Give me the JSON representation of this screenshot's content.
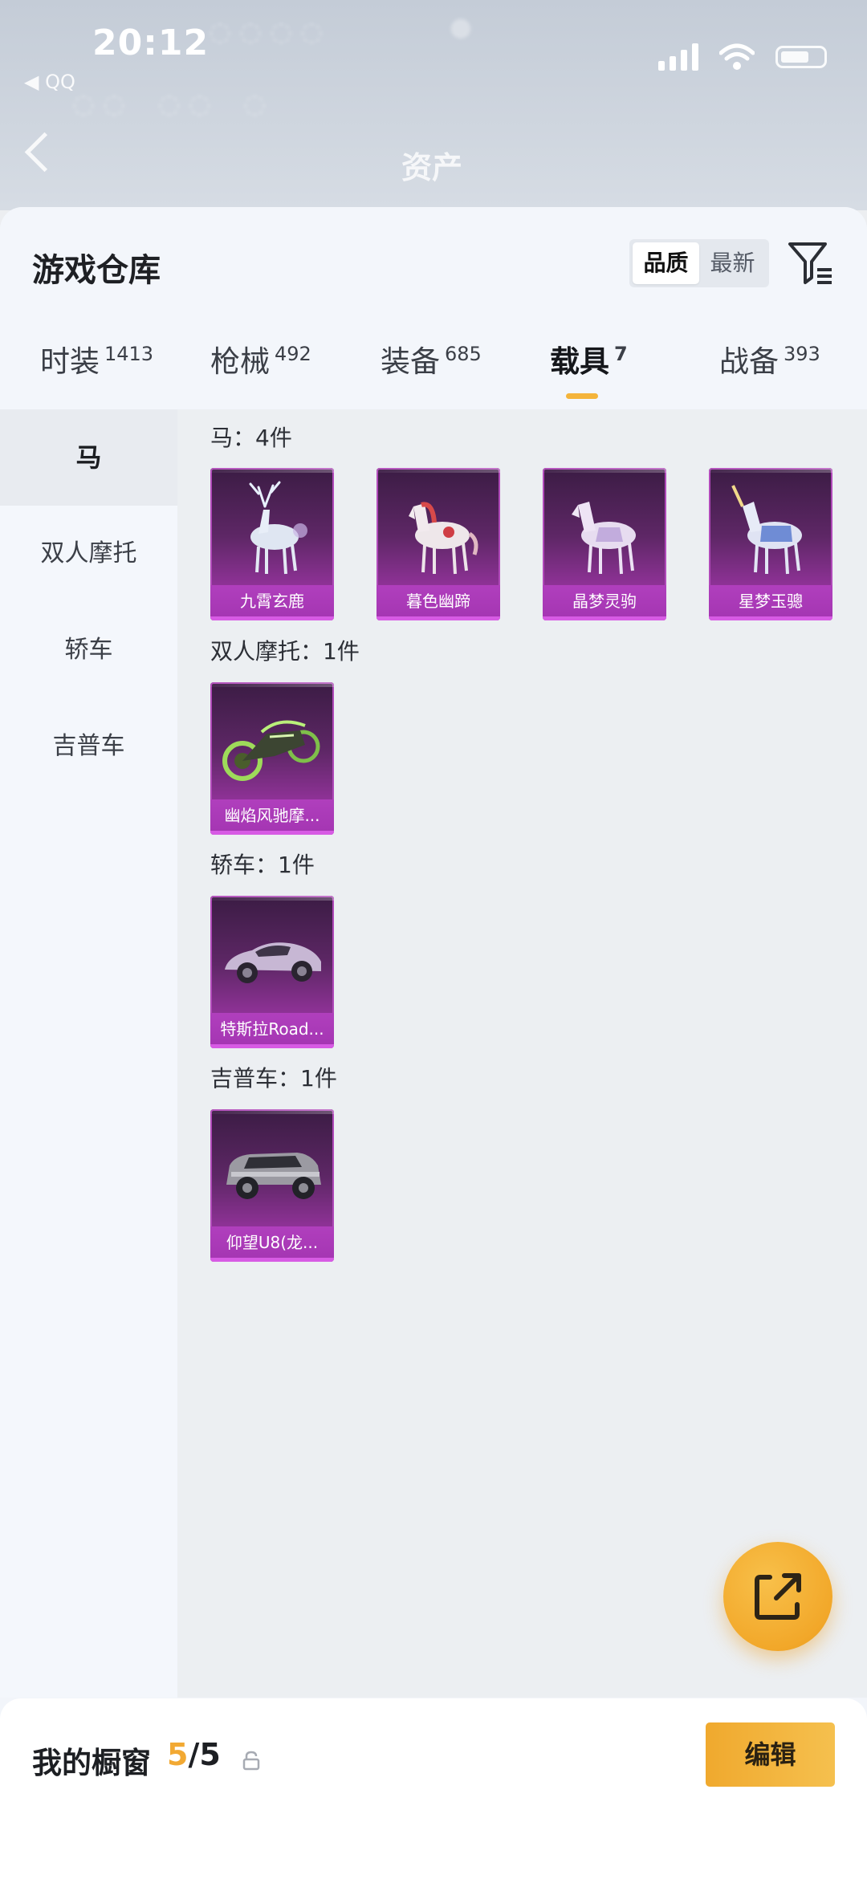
{
  "status_bar": {
    "time": "20:12",
    "back_app": "◀ QQ"
  },
  "nav": {
    "title": "资产"
  },
  "warehouse": {
    "title": "游戏仓库",
    "sort": {
      "quality": "品质",
      "newest": "最新",
      "selected": "品质"
    }
  },
  "tabs": [
    {
      "label": "时装",
      "count": "1413",
      "active": false
    },
    {
      "label": "枪械",
      "count": "492",
      "active": false
    },
    {
      "label": "装备",
      "count": "685",
      "active": false
    },
    {
      "label": "载具",
      "count": "7",
      "active": true
    },
    {
      "label": "战备",
      "count": "393",
      "active": false
    }
  ],
  "sidebar": {
    "items": [
      {
        "label": "马",
        "active": true
      },
      {
        "label": "双人摩托",
        "active": false
      },
      {
        "label": "轿车",
        "active": false
      },
      {
        "label": "吉普车",
        "active": false
      }
    ]
  },
  "groups": [
    {
      "title": "马：4件",
      "items": [
        {
          "name": "九霄玄鹿",
          "icon": "white-deer-icon"
        },
        {
          "name": "暮色幽蹄",
          "icon": "white-red-horse-icon"
        },
        {
          "name": "晶梦灵驹",
          "icon": "crystal-horse-icon"
        },
        {
          "name": "星梦玉骢",
          "icon": "unicorn-icon"
        }
      ]
    },
    {
      "title": "双人摩托：1件",
      "items": [
        {
          "name": "幽焰风驰摩...",
          "icon": "green-motorcycle-icon"
        }
      ]
    },
    {
      "title": "轿车：1件",
      "items": [
        {
          "name": "特斯拉Road...",
          "icon": "sports-car-icon"
        }
      ]
    },
    {
      "title": "吉普车：1件",
      "items": [
        {
          "name": "仰望U8(龙...",
          "icon": "suv-icon"
        }
      ]
    }
  ],
  "showcase": {
    "label": "我的橱窗",
    "current": "5",
    "total": "/5",
    "edit": "编辑"
  },
  "colors": {
    "accent": "#f2a933",
    "card_purple": "#93339b",
    "tab_underline": "#f4b43a"
  }
}
